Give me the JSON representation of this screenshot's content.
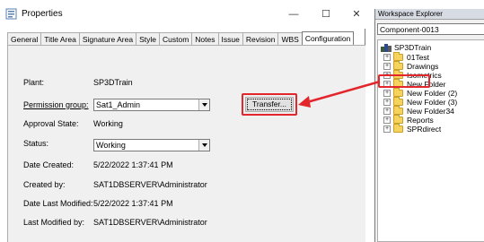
{
  "dialog": {
    "title": "Properties",
    "window_buttons": {
      "minimize": "—",
      "maximize": "☐",
      "close": "✕"
    },
    "tabs": [
      {
        "label": "General",
        "active": false
      },
      {
        "label": "Title Area",
        "active": false
      },
      {
        "label": "Signature Area",
        "active": false
      },
      {
        "label": "Style",
        "active": false
      },
      {
        "label": "Custom",
        "active": false
      },
      {
        "label": "Notes",
        "active": false
      },
      {
        "label": "Issue",
        "active": false
      },
      {
        "label": "Revision",
        "active": false
      },
      {
        "label": "WBS",
        "active": false
      },
      {
        "label": "Configuration",
        "active": true
      }
    ],
    "fields": {
      "plant": {
        "label": "Plant:",
        "value": "SP3DTrain"
      },
      "permission_group": {
        "label": "Permission group:",
        "value": "Sat1_Admin"
      },
      "approval_state": {
        "label": "Approval State:",
        "value": "Working"
      },
      "status": {
        "label": "Status:",
        "value": "Working"
      },
      "date_created": {
        "label": "Date Created:",
        "value": "5/22/2022 1:37:41 PM"
      },
      "created_by": {
        "label": "Created by:",
        "value": "SAT1DBSERVER\\Administrator"
      },
      "date_last_modified": {
        "label": "Date Last Modified:",
        "value": "5/22/2022 1:37:41 PM"
      },
      "last_modified_by": {
        "label": "Last Modified by:",
        "value": "SAT1DBSERVER\\Administrator"
      }
    },
    "transfer_button": "Transfer..."
  },
  "explorer": {
    "title": "Workspace Explorer",
    "combo_value": "Component-0013",
    "tree": {
      "root": "SP3DTrain",
      "items": [
        {
          "label": "01Test"
        },
        {
          "label": "Drawings"
        },
        {
          "label": "Isometrics"
        },
        {
          "label": "New Folder",
          "highlighted": true
        },
        {
          "label": "New Folder (2)"
        },
        {
          "label": "New Folder (3)"
        },
        {
          "label": "New Folder34"
        },
        {
          "label": "Reports"
        },
        {
          "label": "SPRdirect"
        }
      ]
    }
  },
  "colors": {
    "highlight": "#e3262b",
    "folder": "#f5d35c",
    "panel_bg": "#f0f0f0"
  }
}
